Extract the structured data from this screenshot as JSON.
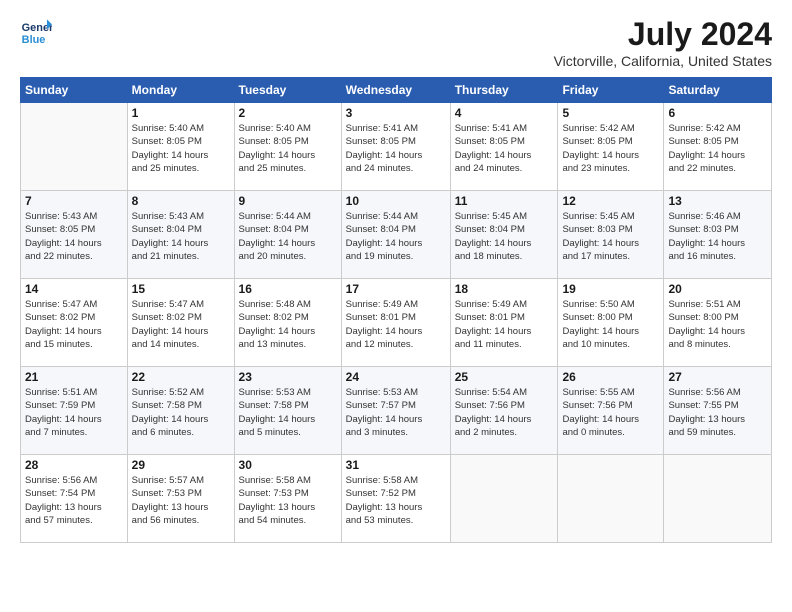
{
  "logo": {
    "line1": "General",
    "line2": "Blue"
  },
  "title": "July 2024",
  "location": "Victorville, California, United States",
  "days_header": [
    "Sunday",
    "Monday",
    "Tuesday",
    "Wednesday",
    "Thursday",
    "Friday",
    "Saturday"
  ],
  "weeks": [
    [
      {
        "num": "",
        "info": ""
      },
      {
        "num": "1",
        "info": "Sunrise: 5:40 AM\nSunset: 8:05 PM\nDaylight: 14 hours\nand 25 minutes."
      },
      {
        "num": "2",
        "info": "Sunrise: 5:40 AM\nSunset: 8:05 PM\nDaylight: 14 hours\nand 25 minutes."
      },
      {
        "num": "3",
        "info": "Sunrise: 5:41 AM\nSunset: 8:05 PM\nDaylight: 14 hours\nand 24 minutes."
      },
      {
        "num": "4",
        "info": "Sunrise: 5:41 AM\nSunset: 8:05 PM\nDaylight: 14 hours\nand 24 minutes."
      },
      {
        "num": "5",
        "info": "Sunrise: 5:42 AM\nSunset: 8:05 PM\nDaylight: 14 hours\nand 23 minutes."
      },
      {
        "num": "6",
        "info": "Sunrise: 5:42 AM\nSunset: 8:05 PM\nDaylight: 14 hours\nand 22 minutes."
      }
    ],
    [
      {
        "num": "7",
        "info": "Sunrise: 5:43 AM\nSunset: 8:05 PM\nDaylight: 14 hours\nand 22 minutes."
      },
      {
        "num": "8",
        "info": "Sunrise: 5:43 AM\nSunset: 8:04 PM\nDaylight: 14 hours\nand 21 minutes."
      },
      {
        "num": "9",
        "info": "Sunrise: 5:44 AM\nSunset: 8:04 PM\nDaylight: 14 hours\nand 20 minutes."
      },
      {
        "num": "10",
        "info": "Sunrise: 5:44 AM\nSunset: 8:04 PM\nDaylight: 14 hours\nand 19 minutes."
      },
      {
        "num": "11",
        "info": "Sunrise: 5:45 AM\nSunset: 8:04 PM\nDaylight: 14 hours\nand 18 minutes."
      },
      {
        "num": "12",
        "info": "Sunrise: 5:45 AM\nSunset: 8:03 PM\nDaylight: 14 hours\nand 17 minutes."
      },
      {
        "num": "13",
        "info": "Sunrise: 5:46 AM\nSunset: 8:03 PM\nDaylight: 14 hours\nand 16 minutes."
      }
    ],
    [
      {
        "num": "14",
        "info": "Sunrise: 5:47 AM\nSunset: 8:02 PM\nDaylight: 14 hours\nand 15 minutes."
      },
      {
        "num": "15",
        "info": "Sunrise: 5:47 AM\nSunset: 8:02 PM\nDaylight: 14 hours\nand 14 minutes."
      },
      {
        "num": "16",
        "info": "Sunrise: 5:48 AM\nSunset: 8:02 PM\nDaylight: 14 hours\nand 13 minutes."
      },
      {
        "num": "17",
        "info": "Sunrise: 5:49 AM\nSunset: 8:01 PM\nDaylight: 14 hours\nand 12 minutes."
      },
      {
        "num": "18",
        "info": "Sunrise: 5:49 AM\nSunset: 8:01 PM\nDaylight: 14 hours\nand 11 minutes."
      },
      {
        "num": "19",
        "info": "Sunrise: 5:50 AM\nSunset: 8:00 PM\nDaylight: 14 hours\nand 10 minutes."
      },
      {
        "num": "20",
        "info": "Sunrise: 5:51 AM\nSunset: 8:00 PM\nDaylight: 14 hours\nand 8 minutes."
      }
    ],
    [
      {
        "num": "21",
        "info": "Sunrise: 5:51 AM\nSunset: 7:59 PM\nDaylight: 14 hours\nand 7 minutes."
      },
      {
        "num": "22",
        "info": "Sunrise: 5:52 AM\nSunset: 7:58 PM\nDaylight: 14 hours\nand 6 minutes."
      },
      {
        "num": "23",
        "info": "Sunrise: 5:53 AM\nSunset: 7:58 PM\nDaylight: 14 hours\nand 5 minutes."
      },
      {
        "num": "24",
        "info": "Sunrise: 5:53 AM\nSunset: 7:57 PM\nDaylight: 14 hours\nand 3 minutes."
      },
      {
        "num": "25",
        "info": "Sunrise: 5:54 AM\nSunset: 7:56 PM\nDaylight: 14 hours\nand 2 minutes."
      },
      {
        "num": "26",
        "info": "Sunrise: 5:55 AM\nSunset: 7:56 PM\nDaylight: 14 hours\nand 0 minutes."
      },
      {
        "num": "27",
        "info": "Sunrise: 5:56 AM\nSunset: 7:55 PM\nDaylight: 13 hours\nand 59 minutes."
      }
    ],
    [
      {
        "num": "28",
        "info": "Sunrise: 5:56 AM\nSunset: 7:54 PM\nDaylight: 13 hours\nand 57 minutes."
      },
      {
        "num": "29",
        "info": "Sunrise: 5:57 AM\nSunset: 7:53 PM\nDaylight: 13 hours\nand 56 minutes."
      },
      {
        "num": "30",
        "info": "Sunrise: 5:58 AM\nSunset: 7:53 PM\nDaylight: 13 hours\nand 54 minutes."
      },
      {
        "num": "31",
        "info": "Sunrise: 5:58 AM\nSunset: 7:52 PM\nDaylight: 13 hours\nand 53 minutes."
      },
      {
        "num": "",
        "info": ""
      },
      {
        "num": "",
        "info": ""
      },
      {
        "num": "",
        "info": ""
      }
    ]
  ]
}
